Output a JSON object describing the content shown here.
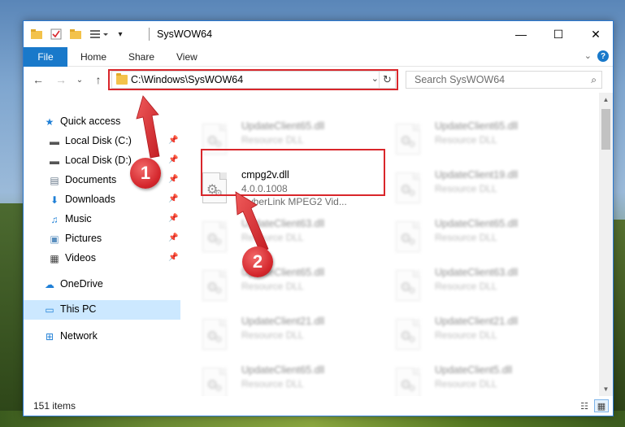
{
  "window": {
    "title": "SysWOW64",
    "buttons": {
      "minimize": "—",
      "maximize": "☐",
      "close": "✕"
    }
  },
  "ribbon": {
    "tabs": [
      "File",
      "Home",
      "Share",
      "View"
    ],
    "expand_glyph": "⌄",
    "help_glyph": "?"
  },
  "nav": {
    "back": "←",
    "forward": "→",
    "recent": "⌄",
    "up": "↑",
    "address": "C:\\Windows\\SysWOW64",
    "address_dropdown": "⌄",
    "refresh": "↻",
    "search_placeholder": "Search SysWOW64",
    "search_glyph": "⌕"
  },
  "sidebar": {
    "items": [
      {
        "label": "Quick access",
        "icon": "star-icon",
        "glyph": "★",
        "color": "#1f7fd6",
        "pinned": false
      },
      {
        "label": "Local Disk (C:)",
        "icon": "drive-icon",
        "glyph": "▬",
        "color": "#555555",
        "pinned": true
      },
      {
        "label": "Local Disk (D:)",
        "icon": "drive-icon",
        "glyph": "▬",
        "color": "#555555",
        "pinned": true
      },
      {
        "label": "Documents",
        "icon": "documents-icon",
        "glyph": "▤",
        "color": "#6b7b8c",
        "pinned": true
      },
      {
        "label": "Downloads",
        "icon": "download-icon",
        "glyph": "⬇",
        "color": "#1f7fd6",
        "pinned": true
      },
      {
        "label": "Music",
        "icon": "music-icon",
        "glyph": "♫",
        "color": "#1f7fd6",
        "pinned": true
      },
      {
        "label": "Pictures",
        "icon": "pictures-icon",
        "glyph": "▣",
        "color": "#5a8fbf",
        "pinned": true
      },
      {
        "label": "Videos",
        "icon": "videos-icon",
        "glyph": "▦",
        "color": "#444444",
        "pinned": true
      },
      {
        "label": "OneDrive",
        "icon": "onedrive-icon",
        "glyph": "☁",
        "color": "#1f7fd6",
        "pinned": false
      },
      {
        "label": "This PC",
        "icon": "pc-icon",
        "glyph": "▭",
        "color": "#1f7fd6",
        "pinned": false
      },
      {
        "label": "Network",
        "icon": "network-icon",
        "glyph": "⊞",
        "color": "#1f7fd6",
        "pinned": false
      }
    ],
    "pin_glyph": "📌"
  },
  "files": [
    {
      "name": "UpdateClient65.dll",
      "line2": "Resource DLL",
      "line3": "",
      "blurred": true
    },
    {
      "name": "UpdateClient65.dll",
      "line2": "Resource DLL",
      "line3": "",
      "blurred": true
    },
    {
      "name": "cmpg2v.dll",
      "line2": "4.0.0.1008",
      "line3": "CyberLink MPEG2 Vid...",
      "blurred": false
    },
    {
      "name": "UpdateClient19.dll",
      "line2": "Resource DLL",
      "line3": "",
      "blurred": true
    },
    {
      "name": "UpdateClient63.dll",
      "line2": "Resource DLL",
      "line3": "",
      "blurred": true
    },
    {
      "name": "UpdateClient65.dll",
      "line2": "Resource DLL",
      "line3": "",
      "blurred": true
    },
    {
      "name": "UpdateClient65.dll",
      "line2": "Resource DLL",
      "line3": "",
      "blurred": true
    },
    {
      "name": "UpdateClient63.dll",
      "line2": "Resource DLL",
      "line3": "",
      "blurred": true
    },
    {
      "name": "UpdateClient21.dll",
      "line2": "Resource DLL",
      "line3": "",
      "blurred": true
    },
    {
      "name": "UpdateClient21.dll",
      "line2": "Resource DLL",
      "line3": "",
      "blurred": true
    },
    {
      "name": "UpdateClient65.dll",
      "line2": "Resource DLL",
      "line3": "",
      "blurred": true
    },
    {
      "name": "UpdateClient5.dll",
      "line2": "Resource DLL",
      "line3": "",
      "blurred": true
    }
  ],
  "scrollbar": {
    "up": "▲",
    "down": "▼"
  },
  "status": {
    "count": "151 items",
    "view_details": "☷",
    "view_tiles": "▦"
  },
  "annotations": {
    "step1": "1",
    "step2": "2",
    "color": "#d9262b"
  }
}
